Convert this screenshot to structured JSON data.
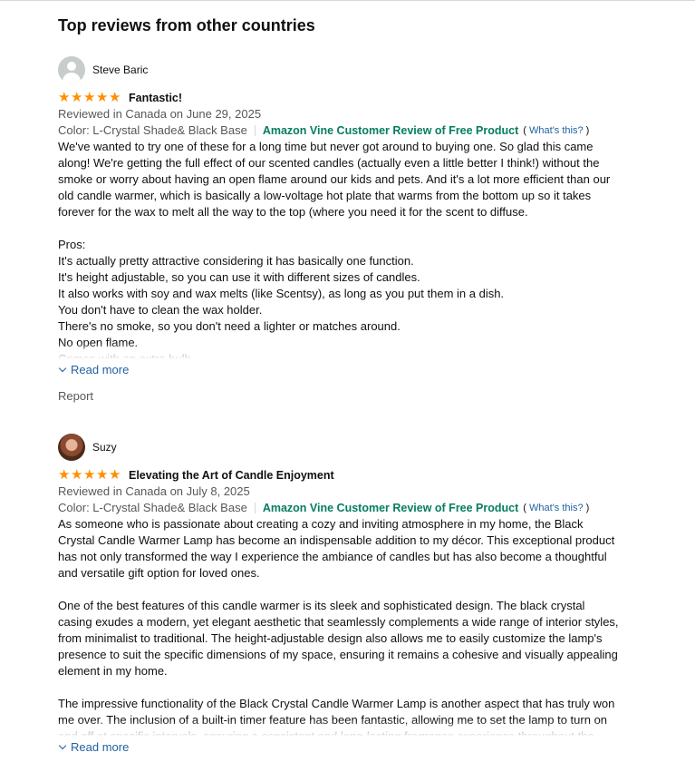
{
  "section_title": "Top reviews from other countries",
  "reviews": [
    {
      "name": "Steve Baric",
      "avatar": "generic-user-icon",
      "title": "Fantastic!",
      "stars": [
        "★",
        "★",
        "★",
        "★",
        "★"
      ],
      "reviewed_in": "Reviewed in Canada on June 29, 2025",
      "color": "Color: L-Crystal Shade& Black Base",
      "vine": "Amazon Vine Customer Review of Free Product",
      "whats_prefix": "(",
      "whats_link": "What's this?",
      "whats_suffix": ")",
      "body": "We've wanted to try one of these for a long time but never got around to buying one. So glad this came along! We're getting the full effect of our scented candles (actually even a little better I think!) without the smoke or worry about having an open flame around our kids and pets. And it's a lot more efficient than our old candle warmer, which is basically a low-voltage hot plate that warms from the bottom up so it takes forever for the wax to melt all the way to the top (where you need it for the scent to diffuse.\n\nPros:\nIt's actually pretty attractive considering it has basically one function.\nIt's height adjustable, so you can use it with different sizes of candles.\nIt also works with soy and wax melts (like Scentsy), as long as you put them in a dish.\nYou don't have to clean the wax holder.\nThere's no smoke, so you don't need a lighter or matches around.\nNo open flame.\nComes with an extra bulb.",
      "read_more": "Read more",
      "report": "Report"
    },
    {
      "name": "Suzy",
      "avatar": "profile-photo",
      "title": "Elevating the Art of Candle Enjoyment",
      "stars": [
        "★",
        "★",
        "★",
        "★",
        "★"
      ],
      "reviewed_in": "Reviewed in Canada on July 8, 2025",
      "color": "Color: L-Crystal Shade& Black Base",
      "vine": "Amazon Vine Customer Review of Free Product",
      "whats_prefix": "(",
      "whats_link": "What's this?",
      "whats_suffix": ")",
      "body": "As someone who is passionate about creating a cozy and inviting atmosphere in my home, the Black Crystal Candle Warmer Lamp has become an indispensable addition to my décor. This exceptional product has not only transformed the way I experience the ambiance of candles but has also become a thoughtful and versatile gift option for loved ones.\n\nOne of the best features of this candle warmer is its sleek and sophisticated design. The black crystal casing exudes a modern, yet elegant aesthetic that seamlessly complements a wide range of interior styles, from minimalist to traditional. The height-adjustable design also allows me to easily customize the lamp's presence to suit the specific dimensions of my space, ensuring it remains a cohesive and visually appealing element in my home.\n\nThe impressive functionality of the Black Crystal Candle Warmer Lamp is another aspect that has truly won me over. The inclusion of a built-in timer feature has been fantastic, allowing me to set the lamp to turn on and off at specific intervals, ensuring a consistent and long-lasting fragrance experience throughout the",
      "read_more": "Read more"
    }
  ],
  "colors": {
    "star": "#ff8f00",
    "vine": "#067d62",
    "link": "#2162a1",
    "muted": "#565959"
  }
}
